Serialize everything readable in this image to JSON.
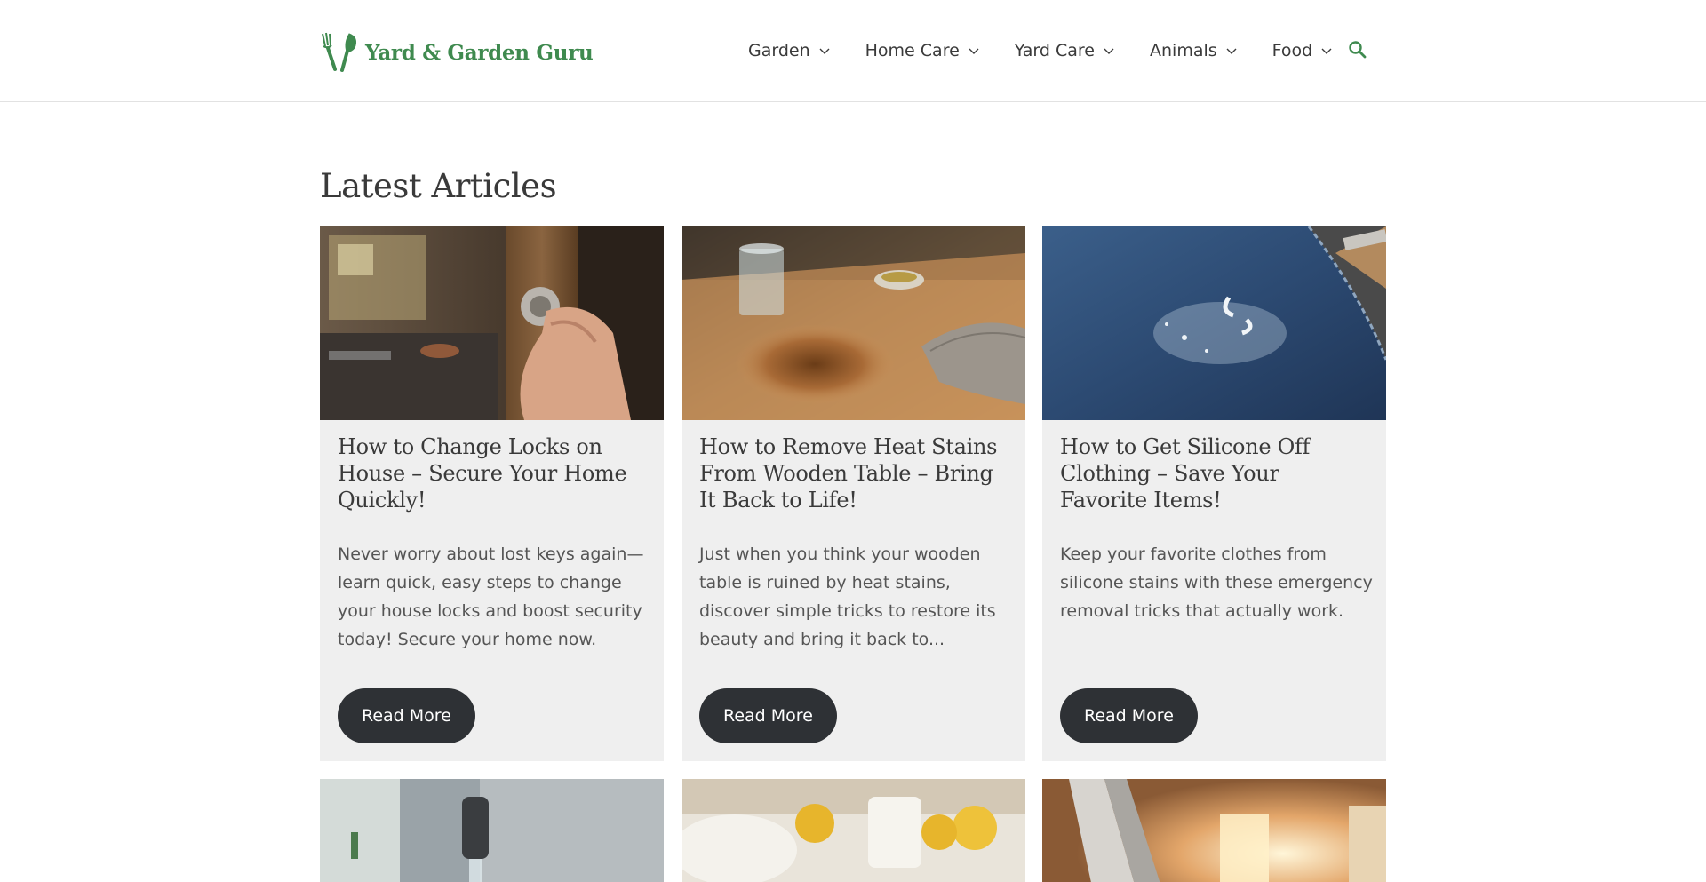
{
  "site": {
    "logo_text": "Yard & Garden Guru",
    "brand_color": "#3f8a4f",
    "logo_icon": "garden-tools-icon"
  },
  "nav": {
    "items": [
      {
        "label": "Garden"
      },
      {
        "label": "Home Care"
      },
      {
        "label": "Yard Care"
      },
      {
        "label": "Animals"
      },
      {
        "label": "Food"
      }
    ],
    "search_icon": "search-icon"
  },
  "section": {
    "title": "Latest Articles"
  },
  "articles": [
    {
      "title": "How to Change Locks on House – Secure Your Home Quickly!",
      "excerpt": "Never worry about lost keys again—learn quick, easy steps to change your house locks and boost security today! Secure your home now.",
      "button": "Read More",
      "image": "door-lock-photo"
    },
    {
      "title": "How to Remove Heat Stains From Wooden Table – Bring It Back to Life!",
      "excerpt": "Just when you think your wooden table is ruined by heat stains, discover simple tricks to restore its beauty and bring it back to...",
      "button": "Read More",
      "image": "wooden-table-photo"
    },
    {
      "title": "How to Get Silicone Off Clothing – Save Your Favorite Items!",
      "excerpt": "Keep your favorite clothes from silicone stains with these emergency removal tricks that actually work.",
      "button": "Read More",
      "image": "denim-silicone-photo"
    }
  ],
  "more_thumbnails": [
    "faucet-photo",
    "lemon-towel-photo",
    "window-light-photo"
  ],
  "colors": {
    "card_bg": "#efefef",
    "button_bg": "#2e3135",
    "text": "#3a3a3a"
  }
}
